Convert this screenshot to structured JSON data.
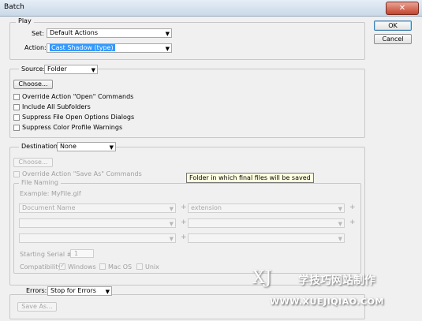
{
  "window": {
    "title": "Batch",
    "close_glyph": "✕"
  },
  "buttons": {
    "ok": "OK",
    "cancel": "Cancel"
  },
  "play": {
    "legend": "Play",
    "set_label": "Set:",
    "set_value": "Default Actions",
    "action_label": "Action:",
    "action_value": "Cast Shadow (type)"
  },
  "source": {
    "label": "Source:",
    "value": "Folder",
    "choose": "Choose...",
    "options": [
      "Override Action \"Open\" Commands",
      "Include All Subfolders",
      "Suppress File Open Options Dialogs",
      "Suppress Color Profile Warnings"
    ]
  },
  "destination": {
    "label": "Destination:",
    "value": "None",
    "choose": "Choose...",
    "override_label": "Override Action \"Save As\" Commands",
    "tooltip": "Folder in which final files will be saved"
  },
  "file_naming": {
    "legend": "File Naming",
    "example": "Example: MyFile.gif",
    "rows": [
      {
        "left": "Document Name",
        "right": "extension"
      },
      {
        "left": "",
        "right": ""
      },
      {
        "left": "",
        "right": ""
      }
    ],
    "plus": "+",
    "serial_label": "Starting Serial #:",
    "serial_value": "1",
    "compat_label": "Compatibility:",
    "compat_windows": "Windows",
    "compat_macos": "Mac OS",
    "compat_unix": "Unix"
  },
  "errors": {
    "label": "Errors:",
    "value": "Stop for Errors",
    "save_as": "Save As..."
  },
  "watermark": {
    "letters": "XJ",
    "chinese": "学技巧网站制作",
    "url": "WWW.XUEJIQIAO.COM"
  },
  "icons": {
    "dropdown": "chevron-down-icon",
    "check": "check-icon"
  }
}
